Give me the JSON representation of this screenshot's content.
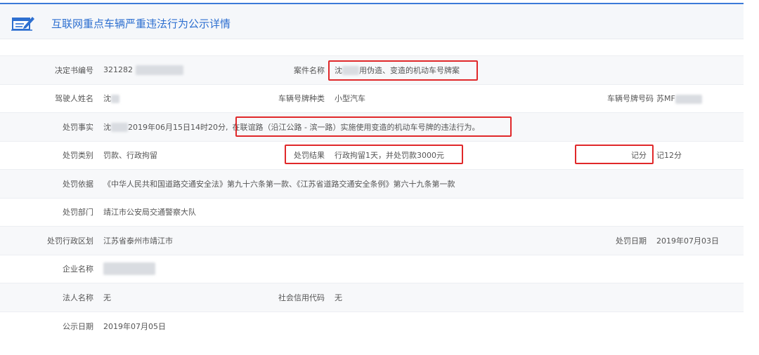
{
  "header": {
    "title": "互联网重点车辆严重违法行为公示详情",
    "icon": "document-edit-icon",
    "accent": "#2d6fd0"
  },
  "highlight_color": "#e0282a",
  "fields": {
    "decision_no": {
      "label": "决定书编号",
      "value": "321282"
    },
    "case_name": {
      "label": "案件名称",
      "value_prefix": "沈",
      "value_suffix": "用伪造、变造的机动车号牌案"
    },
    "driver_name": {
      "label": "驾驶人姓名",
      "value": "沈"
    },
    "plate_type": {
      "label": "车辆号牌种类",
      "value": "小型汽车"
    },
    "plate_no": {
      "label": "车辆号牌号码",
      "value": "苏MF"
    },
    "facts": {
      "label": "处罚事实",
      "value_prefix": "沈",
      "value_date": "2019年06月15日14时20分,",
      "value_highlight": "在联谊路（沿江公路 - 滨一路）实施使用变造的机动车号牌的违法行为。"
    },
    "penalty_type": {
      "label": "处罚类别",
      "value": "罚款、行政拘留"
    },
    "penalty_result": {
      "label": "处罚结果",
      "value": "行政拘留1天，并处罚款3000元"
    },
    "points": {
      "label": "记分",
      "value": "记12分"
    },
    "basis": {
      "label": "处罚依据",
      "value": "《中华人民共和国道路交通安全法》第九十六条第一款、《江苏省道路交通安全条例》第六十九条第一款"
    },
    "department": {
      "label": "处罚部门",
      "value": "靖江市公安局交通警察大队"
    },
    "region": {
      "label": "处罚行政区划",
      "value": "江苏省泰州市靖江市"
    },
    "penalty_date": {
      "label": "处罚日期",
      "value": "2019年07月03日"
    },
    "company": {
      "label": "企业名称",
      "value": ""
    },
    "legal_person": {
      "label": "法人名称",
      "value": "无"
    },
    "credit_code": {
      "label": "社会信用代码",
      "value": "无"
    },
    "publish_date": {
      "label": "公示日期",
      "value": "2019年07月05日"
    }
  }
}
